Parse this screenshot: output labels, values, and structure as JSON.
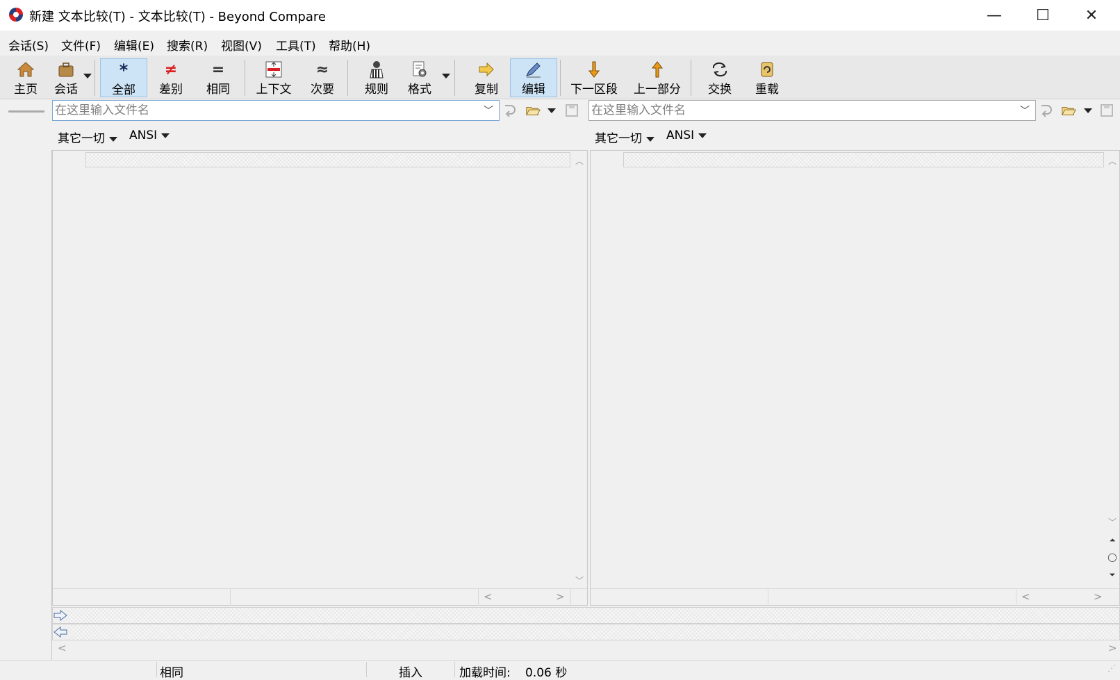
{
  "window": {
    "title": "新建 文本比较(T) - 文本比较(T) - Beyond Compare",
    "minimize_glyph": "—",
    "maximize_glyph": "☐",
    "close_glyph": "✕"
  },
  "menu": [
    "会话(S)",
    "文件(F)",
    "编辑(E)",
    "搜索(R)",
    "视图(V)",
    "工具(T)",
    "帮助(H)"
  ],
  "toolbar": {
    "home": "主页",
    "session": "会话",
    "all": "全部",
    "diffs": "差别",
    "same": "相同",
    "context": "上下文",
    "minor": "次要",
    "rules": "规则",
    "format": "格式",
    "copy": "复制",
    "edit": "编辑",
    "next_section": "下一区段",
    "prev_section": "上一部分",
    "swap": "交换",
    "reload": "重载",
    "active_items": [
      "all",
      "edit"
    ]
  },
  "left": {
    "path_placeholder": "在这里输入文件名",
    "format": "其它一切",
    "encoding": "ANSI"
  },
  "right": {
    "path_placeholder": "在这里输入文件名",
    "format": "其它一切",
    "encoding": "ANSI"
  },
  "status": {
    "state": "相同",
    "mode": "插入",
    "load_label": "加载时间:",
    "load_value": "0.06 秒"
  },
  "colors": {
    "active_bg": "#cde4f7",
    "active_border": "#99c3ea",
    "diff_red": "#d92020",
    "arrow_orange": "#e89a1a",
    "folder_yellow": "#e8c36a"
  }
}
